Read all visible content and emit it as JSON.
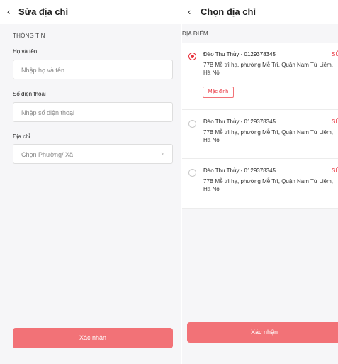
{
  "left": {
    "back_icon": "‹",
    "title": "Sửa địa chỉ",
    "section": "THÔNG TIN",
    "fields": [
      {
        "label": "Họ và tên",
        "placeholder": "Nhập họ và tên"
      },
      {
        "label": "Số điện thoại",
        "placeholder": "Nhập số điện thoại"
      },
      {
        "label": "Địa chỉ",
        "placeholder": "Chọn Phường/ Xã"
      }
    ],
    "chevron": "›",
    "confirm_label": "Xác nhận"
  },
  "right": {
    "back_icon": "‹",
    "title": "Chọn địa chỉ",
    "section": "ĐỊA ĐIỂM",
    "addresses": [
      {
        "name": "Đào Thu Thủy - 0129378345",
        "edit": "SỬ",
        "line": "77B Mễ trì hạ, phường Mễ Trì, Quận Nam Từ Liêm, Hà Nội",
        "selected": true,
        "badge": "Mặc định"
      },
      {
        "name": "Đào Thu Thủy - 0129378345",
        "edit": "SỬ",
        "line": "77B Mễ trì hạ, phường Mễ Trì, Quận Nam Từ Liêm, Hà Nội",
        "selected": false
      },
      {
        "name": "Đào Thu Thủy - 0129378345",
        "edit": "SỬ",
        "line": "77B Mễ trì hạ, phường Mễ Trì, Quận Nam Từ Liêm, Hà Nội",
        "selected": false
      }
    ],
    "confirm_label": "Xác nhận"
  },
  "colors": {
    "accent": "#e8313c",
    "button": "#f27277",
    "background": "#f6f6f8"
  }
}
